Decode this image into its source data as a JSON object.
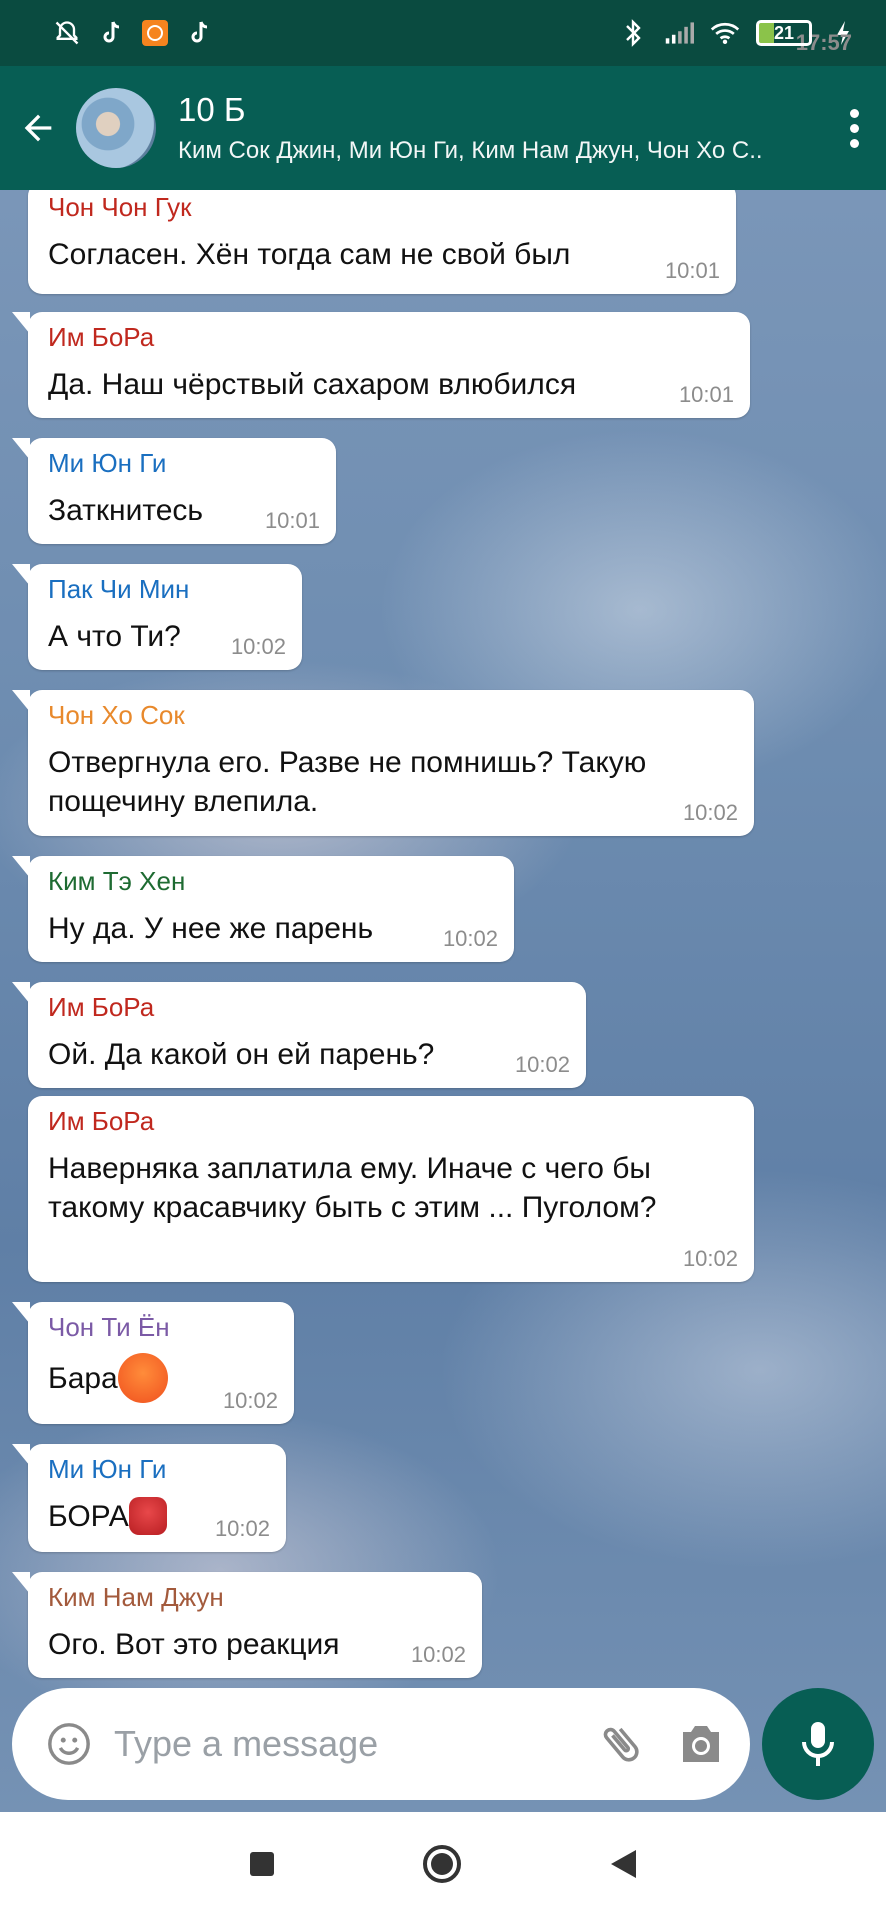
{
  "status_bar": {
    "time": "17:57",
    "battery": "21"
  },
  "header": {
    "title": "10 Б",
    "members": "Ким Сок Джин, Ми Юн Ги, Ким Нам Джун, Чон Хо С.."
  },
  "colors": {
    "header": "#075e54",
    "status_bar": "#0a4b40",
    "bubble": "#ffffff",
    "sender_red": "#c0281e",
    "sender_blue": "#1a6fc0",
    "sender_orange": "#e8892c",
    "sender_green": "#1e6b32",
    "sender_purple": "#7b5aa6",
    "sender_brown": "#a35a3c"
  },
  "messages": [
    {
      "sender": "Чон Чон Гук",
      "text": "Согласен. Хён тогда сам не свой был",
      "time": "10:01"
    },
    {
      "sender": "Им БоРа",
      "text": "Да. Наш чёрствый сахаром влюбился",
      "time": "10:01"
    },
    {
      "sender": "Ми Юн Ги",
      "text": "Заткнитесь",
      "time": "10:01"
    },
    {
      "sender": "Пак Чи Мин",
      "text": "А что Ти?",
      "time": "10:02"
    },
    {
      "sender": "Чон Хо Сок",
      "text": "Отвергнула его. Разве не помнишь? Такую пощечину влепила.",
      "time": "10:02"
    },
    {
      "sender": "Ким Тэ Хен",
      "text": "Ну да. У нее же парень",
      "time": "10:02"
    },
    {
      "sender": "Им БоРа",
      "text": "Ой. Да какой он ей парень?",
      "time": "10:02"
    },
    {
      "sender": "Им БоРа",
      "text": "Наверняка заплатила ему. Иначе с чего бы такому красавчику быть с этим ... Пуголом?",
      "time": "10:02"
    },
    {
      "sender": "Чон Ти Ён",
      "text": "Бара",
      "emoji": "angry-face-emoji",
      "time": "10:02"
    },
    {
      "sender": "Ми Юн Ги",
      "text": "БОРА",
      "emoji": "cursing-face-emoji",
      "time": "10:02"
    },
    {
      "sender": "Ким Нам Джун",
      "text": "Ого. Вот это реакция",
      "time": "10:02"
    }
  ],
  "input": {
    "placeholder": "Type a message"
  }
}
